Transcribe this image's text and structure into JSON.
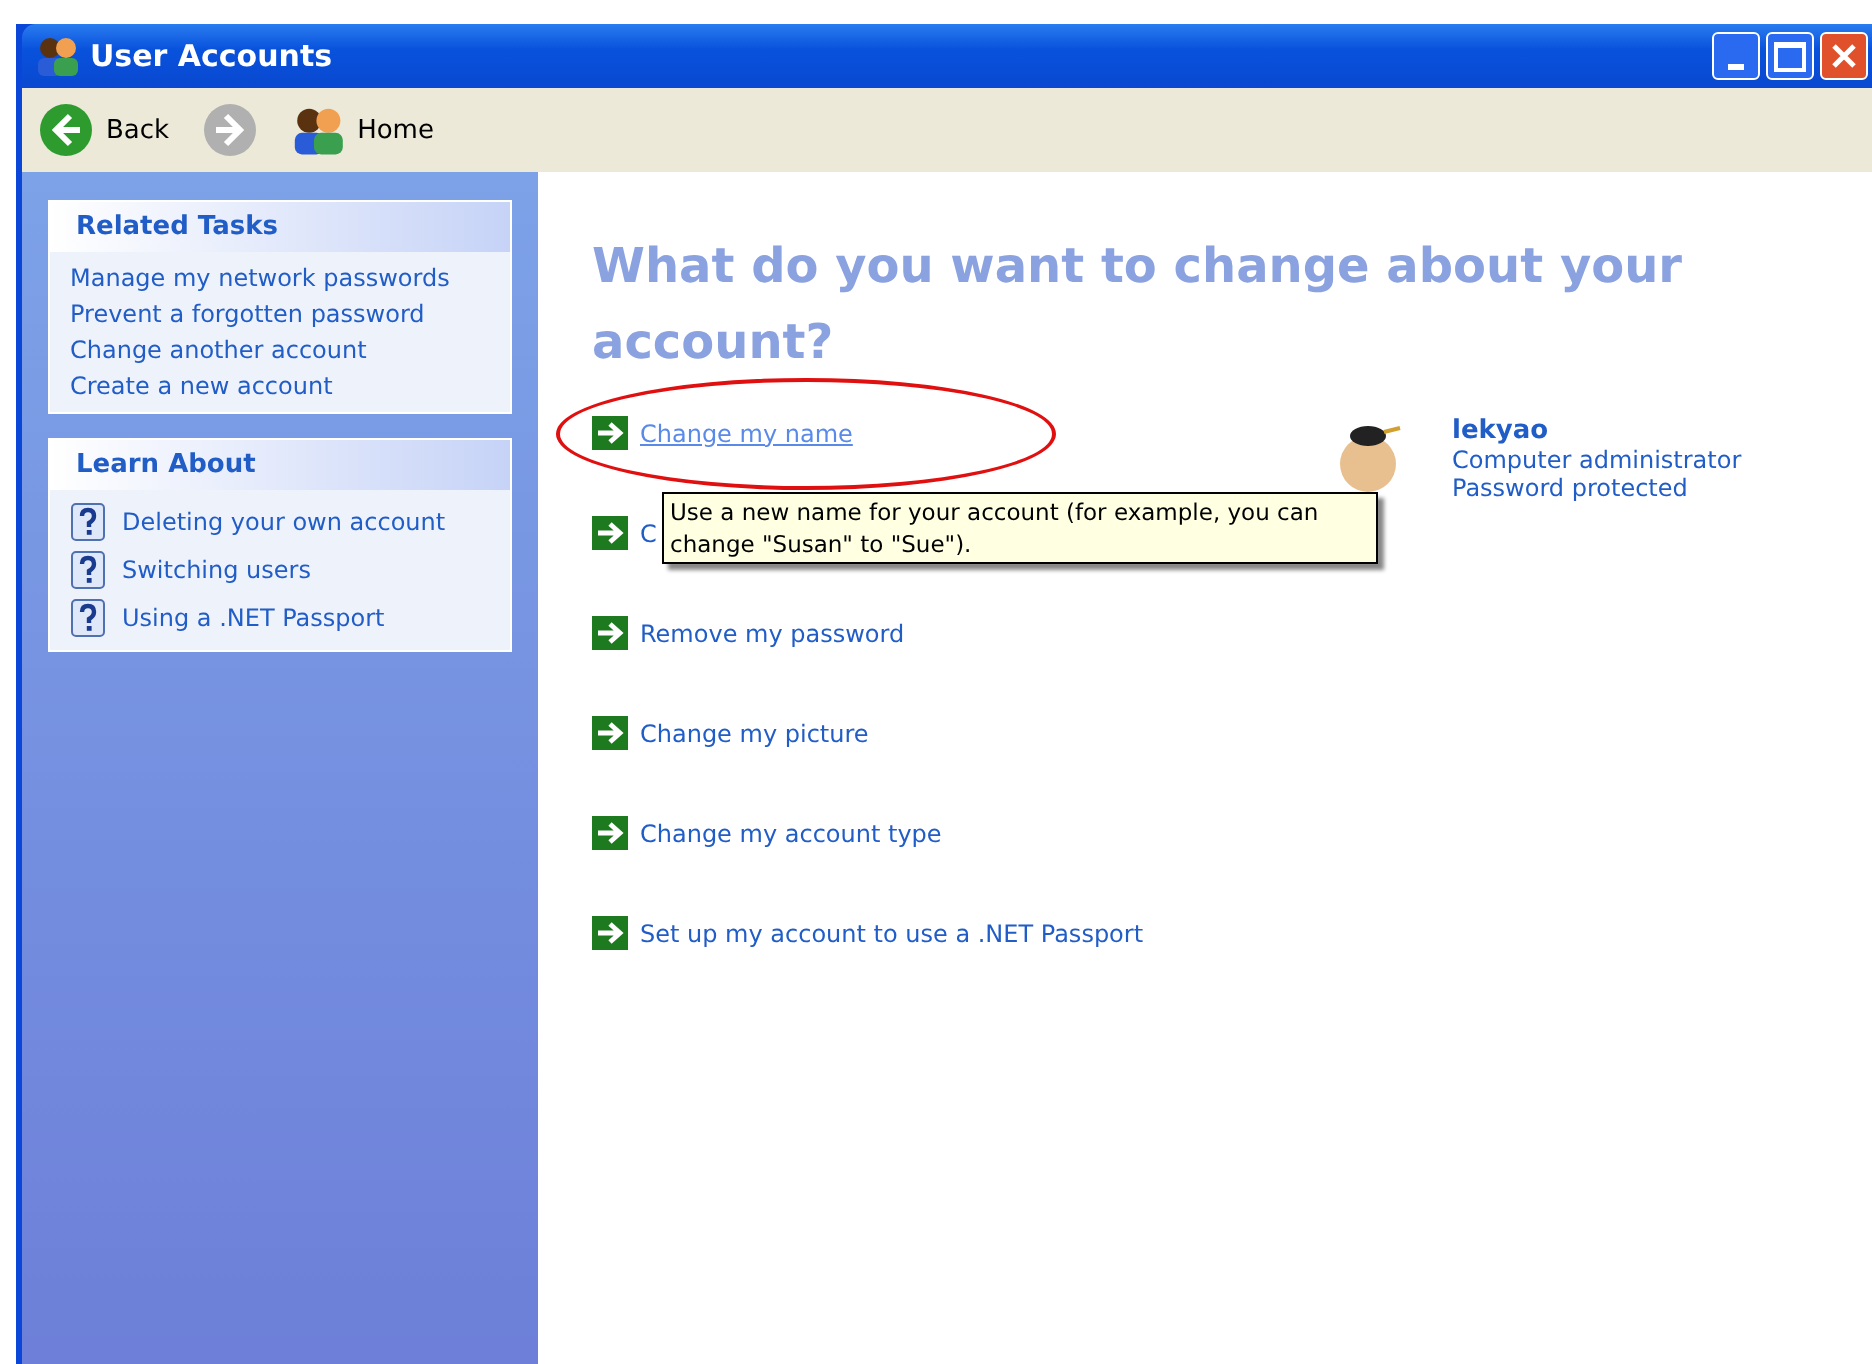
{
  "window": {
    "title": "User Accounts"
  },
  "toolbar": [
    {
      "label": "Back",
      "kind": "back",
      "disabled": false
    },
    {
      "kind": "forward",
      "disabled": true
    },
    {
      "label": "Home",
      "kind": "home",
      "disabled": false
    }
  ],
  "sidebar": [
    {
      "title": "Related Tasks",
      "kind": "tasks",
      "items": [
        "Manage my network passwords",
        "Prevent a forgotten password",
        "Change another account",
        "Create a new account"
      ]
    },
    {
      "title": "Learn About",
      "kind": "help",
      "items": [
        "Deleting your own account",
        "Switching users",
        "Using a .NET Passport"
      ]
    }
  ],
  "heading": "What do you want to change about your account?",
  "actions": [
    {
      "label": "Change my name",
      "hovered": true
    },
    {
      "label": "C",
      "hovered": false
    },
    {
      "label": "Remove my password",
      "hovered": false
    },
    {
      "label": "Change my picture",
      "hovered": false
    },
    {
      "label": "Change my account type",
      "hovered": false
    },
    {
      "label": "Set up my account to use a .NET Passport",
      "hovered": false
    }
  ],
  "account": {
    "name": "lekyao",
    "type": "Computer administrator",
    "status": "Password protected"
  },
  "tooltip": "Use a new name for your account (for example, you can change \"Susan\" to \"Sue\")."
}
